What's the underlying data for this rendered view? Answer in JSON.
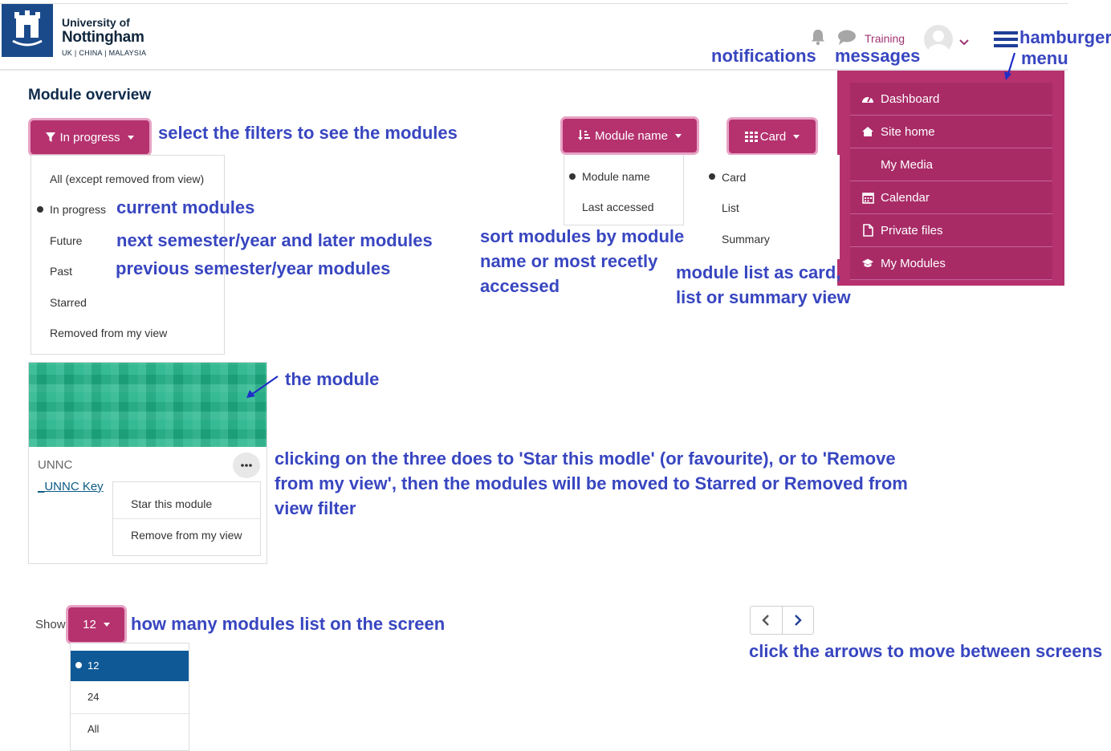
{
  "header": {
    "logo": {
      "line1": "University of",
      "line2": "Nottingham",
      "line3": "UK | CHINA | MALAYSIA"
    },
    "user_link": "Training",
    "icons": [
      "bell-icon",
      "chat-icon",
      "avatar",
      "chevron-down-icon",
      "hamburger-icon"
    ]
  },
  "page_title": "Module overview",
  "filters": {
    "status_button": "In progress",
    "status_options": [
      "All (except removed from view)",
      "In progress",
      "Future",
      "Past",
      "Starred",
      "Removed from my view"
    ],
    "sort_button": "Module name",
    "sort_options": [
      "Module name",
      "Last accessed"
    ],
    "view_button": "Card",
    "view_options": [
      "Card",
      "List",
      "Summary"
    ]
  },
  "nav_menu": {
    "items": [
      {
        "label": "Dashboard",
        "icon": "dashboard-icon"
      },
      {
        "label": "Site home",
        "icon": "home-icon"
      },
      {
        "label": "My Media",
        "icon": ""
      },
      {
        "label": "Calendar",
        "icon": "calendar-icon"
      },
      {
        "label": "Private files",
        "icon": "file-icon"
      },
      {
        "label": "My Modules",
        "icon": "graduation-cap-icon"
      }
    ]
  },
  "module_card": {
    "category": "UNNC",
    "name": "_UNNC Key",
    "menu_items": [
      "Star this module",
      "Remove from my view"
    ]
  },
  "paging": {
    "show_label": "Show",
    "per_page": "12",
    "per_page_options": [
      "12",
      "24",
      "All"
    ]
  },
  "annotations": {
    "notifications": "notifications",
    "messages": "messages",
    "hamburger_1": "hamburger",
    "hamburger_2": "menu",
    "filters": "select the filters to see the modules",
    "current": "current modules",
    "future": "next semester/year and later modules",
    "past": "previous semester/year modules",
    "sort_1": "sort modules by module",
    "sort_2": "name or most recetly",
    "sort_3": "accessed",
    "view_1": "module list as card,",
    "view_2": "list or summary view",
    "module": "the module",
    "three_dots_1": "clicking on the three does to 'Star this modle' (or favourite), or to 'Remove",
    "three_dots_2": "from my view', then the modules will be moved to Starred or Removed from",
    "three_dots_3": "view filter",
    "show": "how many modules list on the screen",
    "arrows": "click the arrows to move between screens"
  },
  "colors": {
    "brand_pink": "#b5326f",
    "annotation_blue": "#3846c0",
    "selected_blue": "#0f5a96",
    "module_green": "#1fb388"
  }
}
